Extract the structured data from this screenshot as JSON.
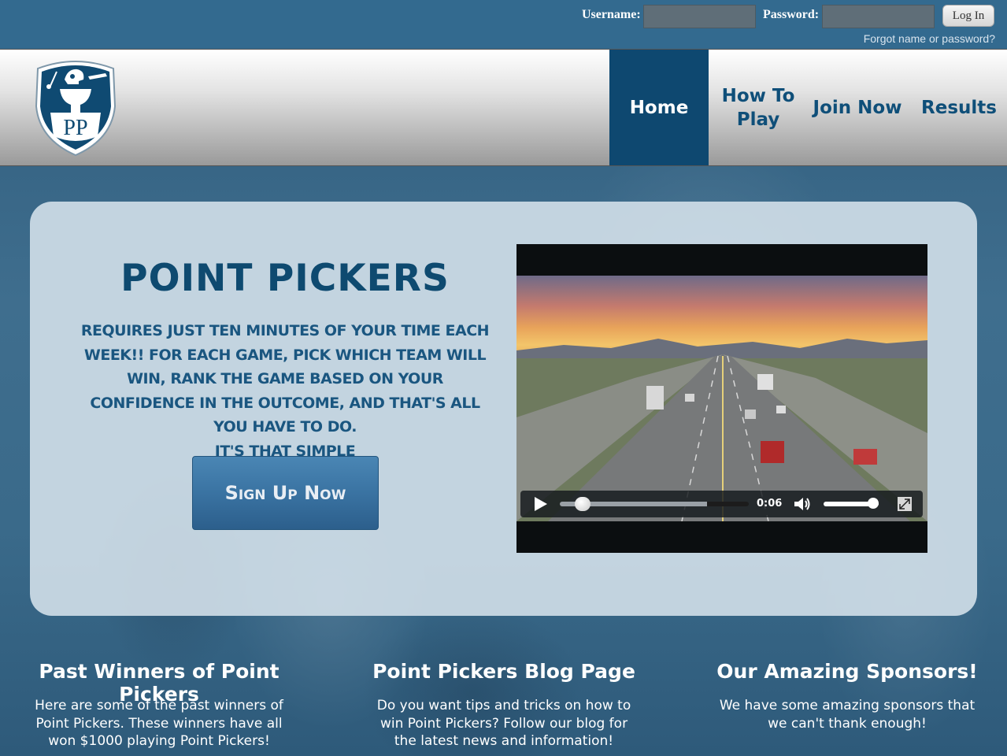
{
  "login": {
    "username_label": "Username:",
    "username_value": "",
    "password_label": "Password:",
    "password_value": "",
    "login_button": "Log In",
    "forgot_link": "Forgot name or password?"
  },
  "logo": {
    "letters": "PP",
    "icons": [
      "golf-club-icon",
      "football-helmet-icon",
      "car-icon",
      "trophy-icon"
    ]
  },
  "nav": {
    "items": [
      {
        "label": "Home",
        "active": true
      },
      {
        "label": "How To Play",
        "active": false
      },
      {
        "label": "Join Now",
        "active": false
      },
      {
        "label": "Results",
        "active": false
      }
    ]
  },
  "hero": {
    "title": "POINT PICKERS",
    "description": "Requires just ten minutes of your time each week!! For each game, pick which team will win, rank the game based on your confidence in the outcome, and that's all you have to do.",
    "tagline": "It's that simple",
    "signup_button": "Sign Up Now"
  },
  "video": {
    "current_time": "0:06",
    "progress_fraction": 0.12,
    "buffered_fraction": 0.78,
    "volume_fraction": 0.9,
    "icons": [
      "play-icon",
      "volume-icon",
      "fullscreen-icon"
    ]
  },
  "columns": [
    {
      "title": "Past Winners of Point Pickers",
      "text": "Here are some of the past winners of Point Pickers. These winners have all won $1000 playing Point Pickers!"
    },
    {
      "title": "Point Pickers Blog Page",
      "text": "Do you want tips and tricks on how to win Point Pickers? Follow our blog for the latest news and information!"
    },
    {
      "title": "Our Amazing Sponsors!",
      "text": "We have some amazing sponsors that we can't thank enough!"
    }
  ],
  "colors": {
    "brand_dark": "#0e4870",
    "login_bar": "#336a8f",
    "button_blue": "#3a73a2",
    "panel": "#d6e2ec"
  }
}
